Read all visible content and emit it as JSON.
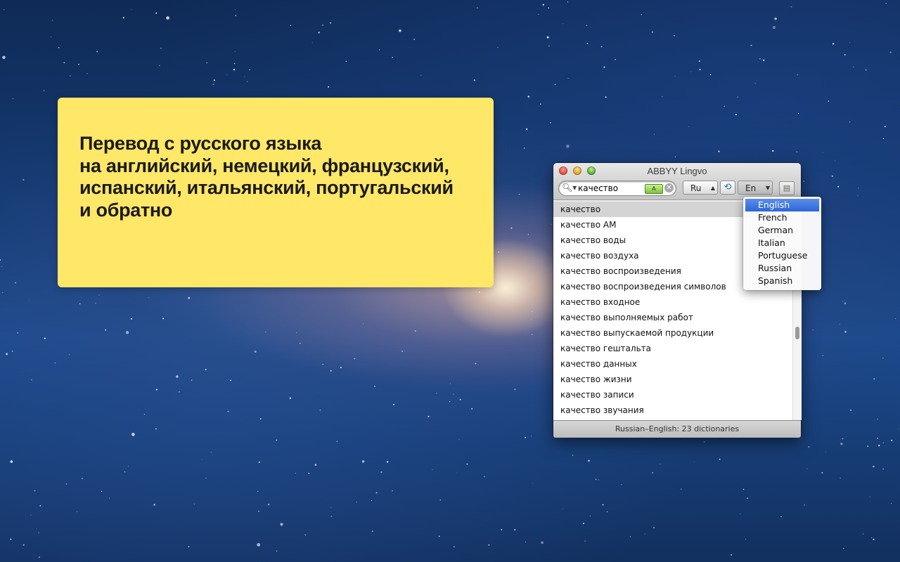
{
  "promo": {
    "lines": [
      "Перевод с русского языка",
      "на английский, немецкий, французский,",
      "испанский, итальянский, португальский",
      "и обратно"
    ]
  },
  "window": {
    "title": "ABBYY Lingvo",
    "search": {
      "value": "качество",
      "placeholder": "",
      "badge": "А"
    },
    "source_lang": "Ru",
    "target_lang": "En",
    "rows": [
      "качество",
      "качество АМ",
      "качество воды",
      "качество воздуха",
      "качество воспроизведения",
      "качество воспроизведения символов",
      "качество входное",
      "качество выполняемых работ",
      "качество выпускаемой продукции",
      "качество гештальта",
      "качество данных",
      "качество жизни",
      "качество записи",
      "качество звучания"
    ],
    "selected_row": 0,
    "status": "Russian–English: 23 dictionaries"
  },
  "lang_menu": {
    "items": [
      "English",
      "French",
      "German",
      "Italian",
      "Portuguese",
      "Russian",
      "Spanish"
    ],
    "highlighted": 0
  },
  "icons": {
    "search": "magnifier-icon",
    "clear": "clear-icon",
    "swap": "swap-arrows-icon",
    "book": "dictionary-book-icon"
  }
}
